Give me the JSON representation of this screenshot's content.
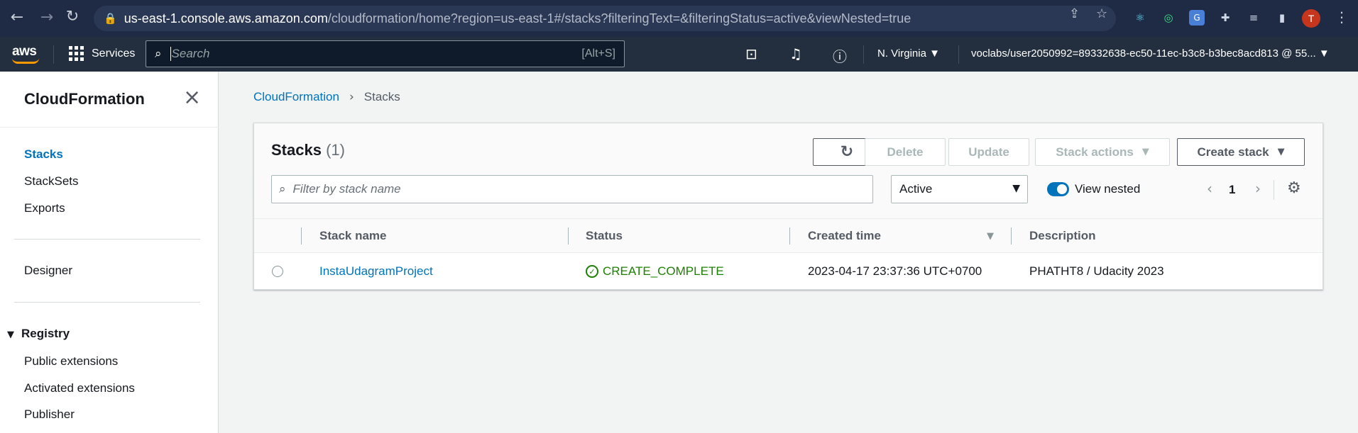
{
  "browser": {
    "url_host": "us-east-1.console.aws.amazon.com",
    "url_path": "/cloudformation/home?region=us-east-1#/stacks?filteringText=&filteringStatus=active&viewNested=true",
    "profile_initial": "T"
  },
  "aws_nav": {
    "logo": "aws",
    "services_label": "Services",
    "search_placeholder": "Search",
    "search_hint": "[Alt+S]",
    "region": "N. Virginia ▼",
    "account": "voclabs/user2050992=89332638-ec50-11ec-b3c8-b3bec8acd813 @ 55... ▼"
  },
  "sidebar": {
    "title": "CloudFormation",
    "items": [
      {
        "label": "Stacks"
      },
      {
        "label": "StackSets"
      },
      {
        "label": "Exports"
      },
      {
        "label": "Designer"
      },
      {
        "label": "Registry"
      },
      {
        "label": "Public extensions"
      },
      {
        "label": "Activated extensions"
      },
      {
        "label": "Publisher"
      }
    ]
  },
  "breadcrumb": {
    "root": "CloudFormation",
    "current": "Stacks"
  },
  "panel": {
    "title": "Stacks",
    "count": "(1)",
    "buttons": {
      "delete": "Delete",
      "update": "Update",
      "stack_actions": "Stack actions",
      "create_stack": "Create stack"
    },
    "filter_placeholder": "Filter by stack name",
    "status_filter": "Active",
    "view_nested_label": "View nested",
    "page": "1"
  },
  "table": {
    "columns": [
      "Stack name",
      "Status",
      "Created time",
      "Description"
    ],
    "rows": [
      {
        "stack_name": "InstaUdagramProject",
        "status": "CREATE_COMPLETE",
        "created_time": "2023-04-17 23:37:36 UTC+0700",
        "description": "PHATHT8 / Udacity 2023"
      }
    ]
  },
  "colors": {
    "accent": "#0073bb",
    "status_ok": "#1d8102",
    "nav_bg": "#232f3e",
    "aws_orange": "#ff9900"
  },
  "icons": [
    "back-icon",
    "forward-icon",
    "reload-icon",
    "lock-icon",
    "share-icon",
    "star-icon",
    "grid-icon",
    "search-icon",
    "cloudshell-icon",
    "bell-icon",
    "help-icon",
    "close-icon",
    "refresh-icon",
    "gear-icon",
    "check-circle-icon"
  ]
}
